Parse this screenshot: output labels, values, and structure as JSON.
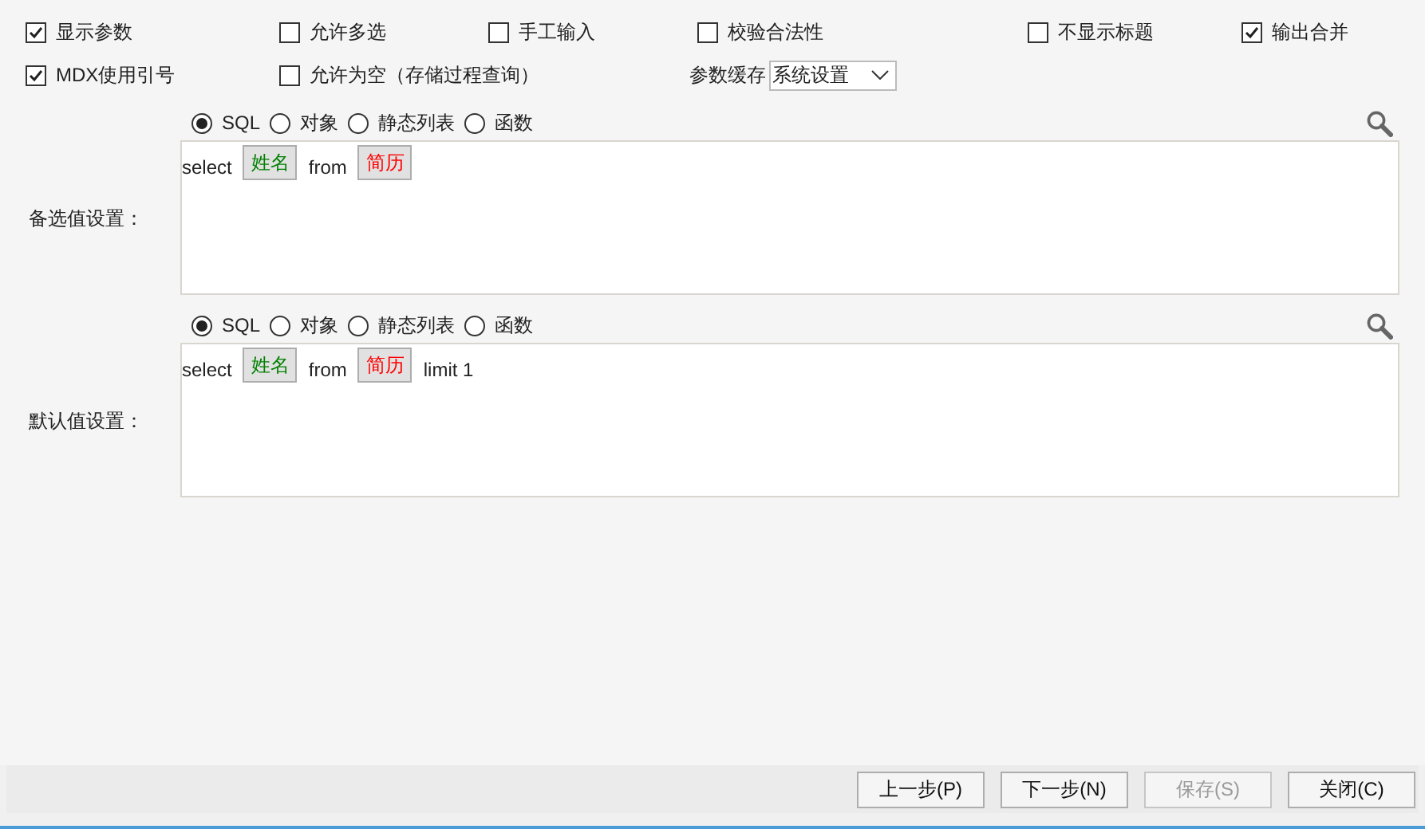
{
  "options_row1": [
    {
      "label": "显示参数",
      "checked": true
    },
    {
      "label": "允许多选",
      "checked": false
    },
    {
      "label": "手工输入",
      "checked": false
    },
    {
      "label": "校验合法性",
      "checked": false
    },
    {
      "label": "不显示标题",
      "checked": false
    },
    {
      "label": "输出合并",
      "checked": true
    }
  ],
  "options_row2": [
    {
      "label": "MDX使用引号",
      "checked": true
    },
    {
      "label": "允许为空（存储过程查询）",
      "checked": false
    }
  ],
  "param_cache": {
    "label": "参数缓存",
    "value": "系统设置"
  },
  "sections": [
    {
      "label": "备选值设置：",
      "sources": [
        {
          "label": "SQL",
          "selected": true
        },
        {
          "label": "对象",
          "selected": false
        },
        {
          "label": "静态列表",
          "selected": false
        },
        {
          "label": "函数",
          "selected": false
        }
      ],
      "tokens": [
        {
          "kind": "text",
          "text": "select"
        },
        {
          "kind": "column",
          "text": "姓名"
        },
        {
          "kind": "text",
          "text": "from"
        },
        {
          "kind": "table",
          "text": "简历"
        }
      ]
    },
    {
      "label": "默认值设置：",
      "sources": [
        {
          "label": "SQL",
          "selected": true
        },
        {
          "label": "对象",
          "selected": false
        },
        {
          "label": "静态列表",
          "selected": false
        },
        {
          "label": "函数",
          "selected": false
        }
      ],
      "tokens": [
        {
          "kind": "text",
          "text": "select"
        },
        {
          "kind": "column",
          "text": "姓名"
        },
        {
          "kind": "text",
          "text": "from"
        },
        {
          "kind": "table",
          "text": "简历"
        },
        {
          "kind": "text",
          "text": "limit 1"
        }
      ]
    }
  ],
  "buttons": [
    {
      "label": "上一步(P)",
      "disabled": false
    },
    {
      "label": "下一步(N)",
      "disabled": false
    },
    {
      "label": "保存(S)",
      "disabled": true
    },
    {
      "label": "关闭(C)",
      "disabled": false
    }
  ]
}
